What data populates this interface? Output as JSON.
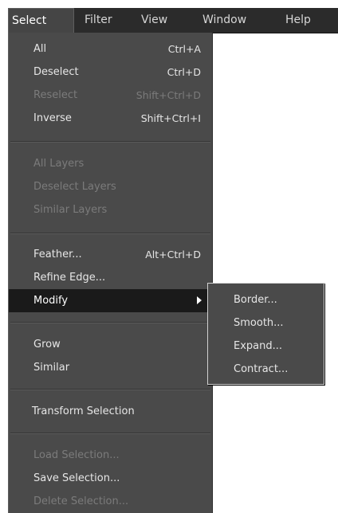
{
  "menubar": {
    "items": [
      {
        "label": "Select",
        "active": true
      },
      {
        "label": "Filter"
      },
      {
        "label": "View"
      },
      {
        "label": "Window"
      },
      {
        "label": "Help"
      }
    ]
  },
  "dropdown": {
    "items": [
      {
        "label": "All",
        "shortcut": "Ctrl+A"
      },
      {
        "label": "Deselect",
        "shortcut": "Ctrl+D"
      },
      {
        "label": "Reselect",
        "shortcut": "Shift+Ctrl+D",
        "disabled": true
      },
      {
        "label": "Inverse",
        "shortcut": "Shift+Ctrl+I"
      },
      {
        "label": "All Layers",
        "disabled": true
      },
      {
        "label": "Deselect Layers",
        "disabled": true
      },
      {
        "label": "Similar Layers",
        "disabled": true
      },
      {
        "label": "Feather...",
        "shortcut": "Alt+Ctrl+D"
      },
      {
        "label": "Refine Edge..."
      },
      {
        "label": "Modify",
        "has_submenu": true,
        "highlighted": true
      },
      {
        "label": "Grow"
      },
      {
        "label": "Similar"
      },
      {
        "label": "Transform Selection"
      },
      {
        "label": "Load Selection...",
        "disabled": true
      },
      {
        "label": "Save Selection..."
      },
      {
        "label": "Delete Selection...",
        "disabled": true
      }
    ]
  },
  "submenu": {
    "items": [
      {
        "label": "Border..."
      },
      {
        "label": "Smooth..."
      },
      {
        "label": "Expand..."
      },
      {
        "label": "Contract..."
      }
    ]
  },
  "colors": {
    "menubar_bg": "#2b2b2b",
    "menu_bg": "#4a4a4a",
    "highlight_bg": "#1a1a1a",
    "text": "#e6e6e6",
    "disabled_text": "#7b7b7b"
  }
}
